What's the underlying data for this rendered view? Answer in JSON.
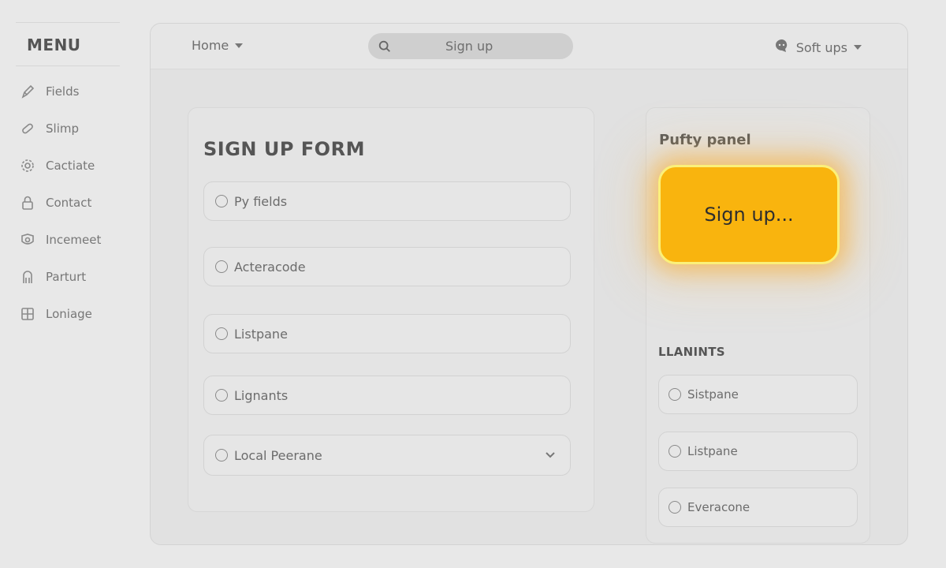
{
  "sidebar": {
    "title": "MENU",
    "items": [
      {
        "label": "Fields",
        "icon": "pencil-icon"
      },
      {
        "label": "Slimp",
        "icon": "link-icon"
      },
      {
        "label": "Cactiate",
        "icon": "gear-icon"
      },
      {
        "label": "Contact",
        "icon": "lock-icon"
      },
      {
        "label": "Incemeet",
        "icon": "badge-icon"
      },
      {
        "label": "Parturt",
        "icon": "person-icon"
      },
      {
        "label": "Loniage",
        "icon": "grid-icon"
      }
    ]
  },
  "topbar": {
    "home_label": "Home",
    "search_placeholder": "Sign up",
    "soft_ups_label": "Soft ups"
  },
  "form": {
    "title": "SIGN UP FORM",
    "fields": [
      {
        "label": "Py fields"
      },
      {
        "label": "Acteracode"
      },
      {
        "label": "Listpane"
      },
      {
        "label": "Lignants"
      },
      {
        "label": "Local Peerane"
      }
    ]
  },
  "panel": {
    "title": "Pufty panel",
    "signup_button": "Sign up...",
    "section_title": "LLANINTS",
    "options": [
      {
        "label": "Sistpane"
      },
      {
        "label": "Listpane"
      },
      {
        "label": "Everacone"
      }
    ]
  },
  "colors": {
    "accent": "#f9b40e",
    "accent_border": "#fbf07a",
    "background": "#e8e8e8"
  }
}
